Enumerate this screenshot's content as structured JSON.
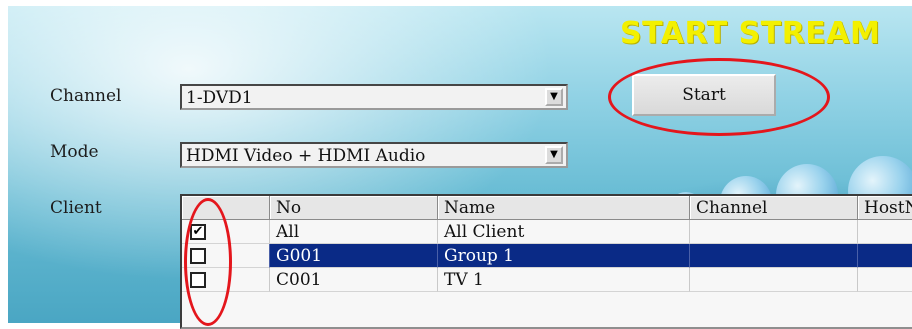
{
  "title": "START STREAM",
  "form": {
    "channel": {
      "label": "Channel",
      "value": "1-DVD1"
    },
    "mode": {
      "label": "Mode",
      "value": "HDMI Video + HDMI Audio"
    },
    "client_label": "Client"
  },
  "start_button": {
    "label": "Start"
  },
  "client_table": {
    "columns": [
      "",
      "No",
      "Name",
      "Channel",
      "HostN"
    ],
    "rows": [
      {
        "checked": true,
        "no": "All",
        "name": "All Client",
        "channel": "",
        "host": ""
      },
      {
        "checked": false,
        "no": "G001",
        "name": "Group 1",
        "channel": "",
        "host": "",
        "selected": true
      },
      {
        "checked": false,
        "no": "C001",
        "name": "TV 1",
        "channel": "",
        "host": ""
      }
    ]
  },
  "icons": {
    "dropdown": "chevron-down-icon",
    "checkbox_checked": "checkbox-checked-icon",
    "checkbox_unchecked": "checkbox-unchecked-icon"
  },
  "colors": {
    "title": "#f3f000",
    "annotation": "#e4161c",
    "selection": "#0a2a86"
  },
  "symbols": {
    "check": "✔",
    "arrow_down": "▼"
  }
}
